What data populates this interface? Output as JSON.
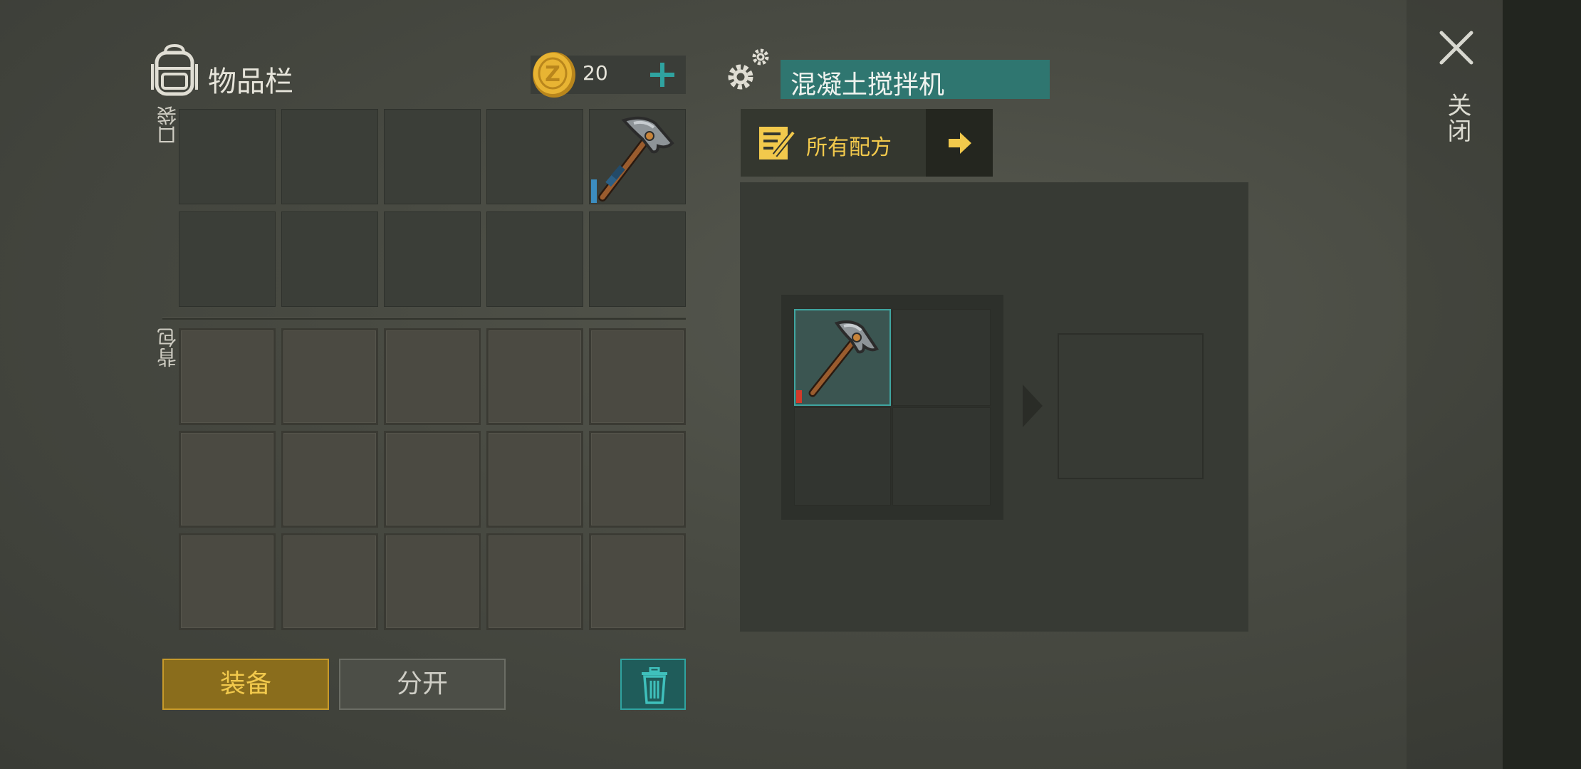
{
  "inventory": {
    "title": "物品栏",
    "coins": "20",
    "pocket_label": "口袋",
    "backpack_label": "背包",
    "pocket_item": "pickaxe-icon"
  },
  "buttons": {
    "equip": "装备",
    "split": "分开"
  },
  "crafting": {
    "station_title": "混凝土搅拌机",
    "recipes_label": "所有配方",
    "input_item": "pickaxe-icon"
  },
  "close": {
    "label": "关闭"
  },
  "colors": {
    "teal": "#2f7670",
    "gold": "#f2c94c",
    "equip_bg": "#8a6d1c",
    "durability_blue": "#3c8dc0",
    "durability_red": "#d23a2a"
  }
}
